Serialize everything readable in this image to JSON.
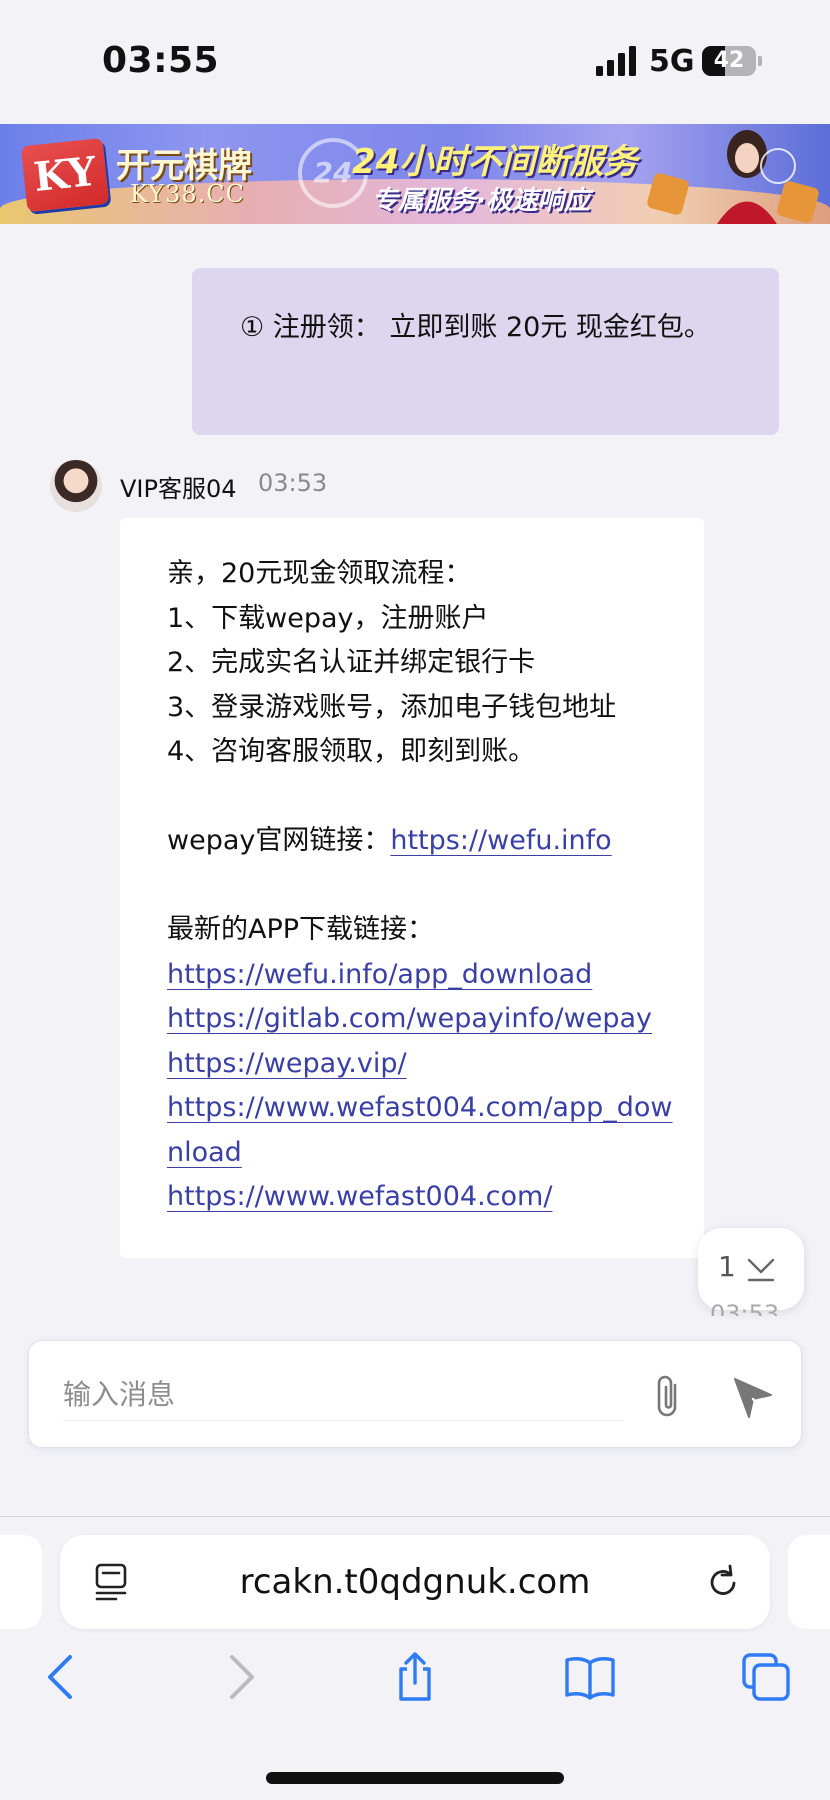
{
  "status_bar": {
    "time": "03:55",
    "network": "5G",
    "battery_level": "42",
    "battery_fraction": 0.42
  },
  "banner": {
    "brand_logo": "KY",
    "brand_cn": "开元棋牌",
    "brand_domain": "KY38.CC",
    "badge": "24",
    "slogan_line1": "24小时不间断服务",
    "slogan_line2": "专属服务·极速响应"
  },
  "chat": {
    "outgoing_message": "① 注册领： 立即到账 20元 现金红包。",
    "agent": {
      "name": "VIP客服04",
      "time": "03:53"
    },
    "incoming": {
      "lines": [
        "亲，20元现金领取流程：",
        "1、下载wepay，注册账户",
        "2、完成实名认证并绑定银行卡",
        "3、登录游戏账号，添加电子钱包地址",
        "4、咨询客服领取，即刻到账。"
      ],
      "official_label": "wepay官网链接：",
      "official_link": "https://wefu.info",
      "download_label": "最新的APP下载链接：",
      "download_links": [
        "https://wefu.info/app_download",
        "https://gitlab.com/wepayinfo/wepay",
        "https://wepay.vip/",
        "https://www.wefast004.com/app_download",
        "https://www.wefast004.com/"
      ]
    },
    "unread_count": "1",
    "peek_time": "03:53"
  },
  "composer": {
    "placeholder": "输入消息"
  },
  "browser": {
    "url": "rcakn.t0qdgnuk.com"
  },
  "colors": {
    "link": "#3a3fa6",
    "outgoing_bubble": "#ddd6ee",
    "ios_blue": "#2f7bf5"
  },
  "icons": [
    "signal-icon",
    "battery-icon",
    "avatar",
    "attach-icon",
    "send-icon",
    "scroll-down-icon",
    "reader-icon",
    "reload-icon",
    "back-icon",
    "forward-icon",
    "share-icon",
    "bookmarks-icon",
    "tabs-icon"
  ]
}
